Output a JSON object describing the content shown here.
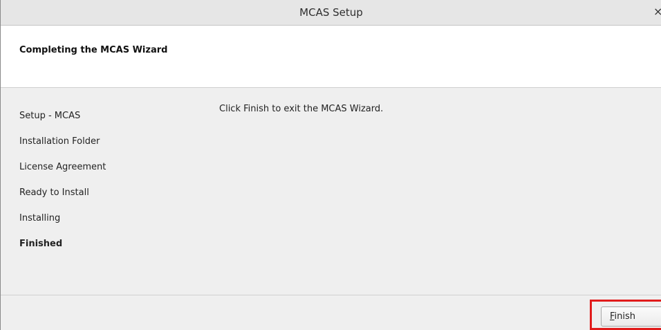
{
  "window": {
    "title": "MCAS Setup",
    "close_glyph": "×"
  },
  "header": {
    "title": "Completing the MCAS Wizard"
  },
  "steps": [
    {
      "label": "Setup - MCAS",
      "current": false
    },
    {
      "label": "Installation Folder",
      "current": false
    },
    {
      "label": "License Agreement",
      "current": false
    },
    {
      "label": "Ready to Install",
      "current": false
    },
    {
      "label": "Installing",
      "current": false
    },
    {
      "label": "Finished",
      "current": true
    }
  ],
  "content": {
    "message": "Click Finish to exit the MCAS Wizard."
  },
  "footer": {
    "finish_label": "Finish",
    "finish_mnemonic": "F",
    "finish_rest": "inish",
    "highlight_color": "#e11b1b"
  }
}
